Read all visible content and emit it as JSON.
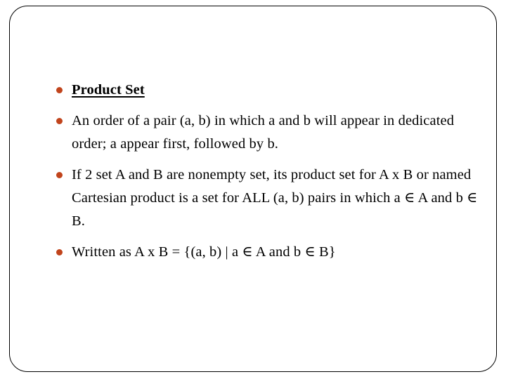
{
  "slide": {
    "frame_color": "#000000",
    "background_color": "#ffffff",
    "bullet_color": "#C1441C",
    "text_color": "#000000",
    "items": [
      {
        "id": "product-set-heading",
        "style": "heading",
        "text": "Product Set"
      },
      {
        "id": "ordered-pair-definition",
        "style": "body",
        "text": "An order of a pair (a, b) in which a and b will appear in dedicated order; a appear first, followed by b."
      },
      {
        "id": "cartesian-product-definition",
        "style": "body",
        "text": "If 2 set A and B are nonempty set, its product set for A x B or named Cartesian product is a set for ALL (a, b) pairs in which a ∈ A and b ∈ B."
      },
      {
        "id": "set-builder-notation",
        "style": "body",
        "text": "Written as A x B = {(a, b) | a ∈ A and b ∈ B}"
      }
    ]
  }
}
